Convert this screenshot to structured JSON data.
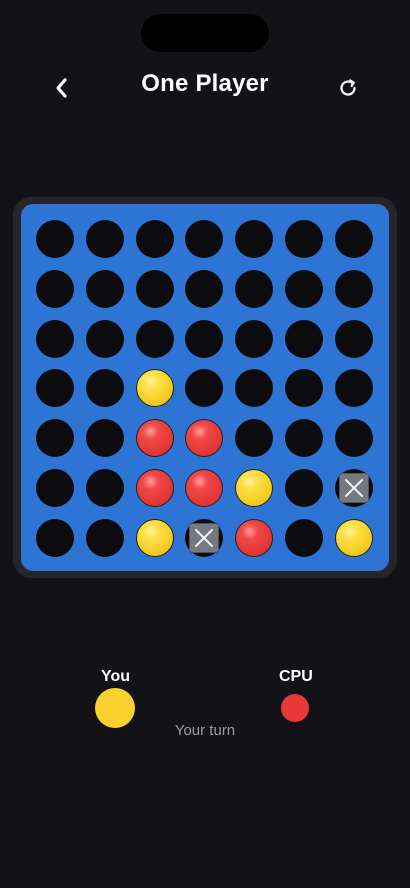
{
  "header": {
    "title": "One Player",
    "back_icon": "chevron-left-icon",
    "restart_icon": "restart-icon"
  },
  "colors": {
    "background": "#131317",
    "board": "#2e74d4",
    "yellow": "#f4c81c",
    "red": "#e03535",
    "empty": "#0c0c0f",
    "blocked": "#767a80"
  },
  "board": {
    "columns": 7,
    "rows": 7,
    "grid": [
      [
        "empty",
        "empty",
        "empty",
        "empty",
        "empty",
        "empty",
        "empty"
      ],
      [
        "empty",
        "empty",
        "empty",
        "empty",
        "empty",
        "empty",
        "empty"
      ],
      [
        "empty",
        "empty",
        "empty",
        "empty",
        "empty",
        "empty",
        "empty"
      ],
      [
        "empty",
        "empty",
        "yellow",
        "empty",
        "empty",
        "empty",
        "empty"
      ],
      [
        "empty",
        "empty",
        "red",
        "red",
        "empty",
        "empty",
        "empty"
      ],
      [
        "empty",
        "empty",
        "red",
        "red",
        "yellow",
        "empty",
        "blocked"
      ],
      [
        "empty",
        "empty",
        "yellow",
        "blocked",
        "red",
        "empty",
        "yellow"
      ]
    ]
  },
  "players": {
    "you": {
      "label": "You",
      "color": "yellow"
    },
    "cpu": {
      "label": "CPU",
      "color": "red"
    }
  },
  "status": "Your turn"
}
